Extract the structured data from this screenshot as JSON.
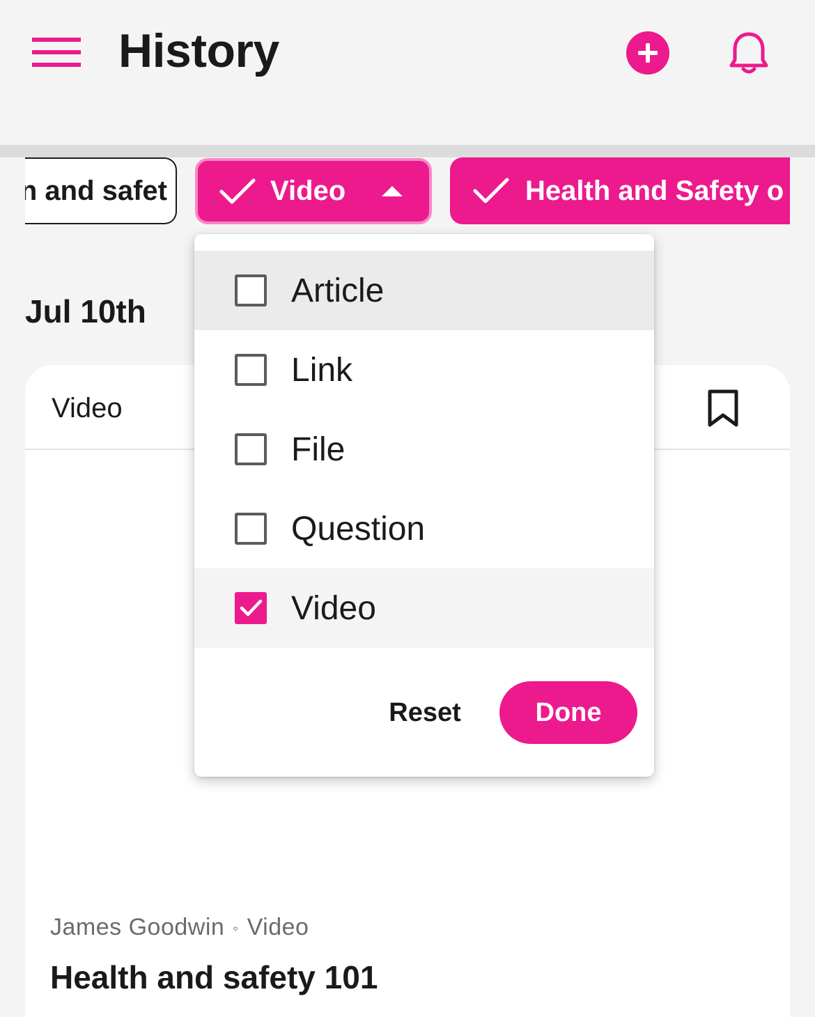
{
  "header": {
    "title": "History",
    "menu_icon": "hamburger-menu-icon",
    "add_icon": "plus-circle-icon",
    "notifications_icon": "bell-icon"
  },
  "filters": {
    "chips": [
      {
        "label": "n and safet",
        "state": "outline"
      },
      {
        "label": "Video",
        "state": "active",
        "icon": "check-icon",
        "trailing_icon": "caret-up-icon"
      },
      {
        "label": "Health and Safety o",
        "state": "filled",
        "icon": "check-icon"
      }
    ]
  },
  "content": {
    "date_heading": "Jul 10th",
    "card": {
      "type_label": "Video",
      "bookmark_icon": "bookmark-icon",
      "author": "James Goodwin",
      "separator": "◦",
      "media_type": "Video",
      "title": "Health and safety 101"
    }
  },
  "dropdown": {
    "options": [
      {
        "label": "Article",
        "checked": false
      },
      {
        "label": "Link",
        "checked": false
      },
      {
        "label": "File",
        "checked": false
      },
      {
        "label": "Question",
        "checked": false
      },
      {
        "label": "Video",
        "checked": true
      }
    ],
    "reset_label": "Reset",
    "done_label": "Done"
  },
  "colors": {
    "accent": "#ec1a8d",
    "accent_light": "#f78ac6",
    "background": "#f4f4f4",
    "text": "#1a1a1a",
    "muted_text": "#6b6b6b"
  }
}
